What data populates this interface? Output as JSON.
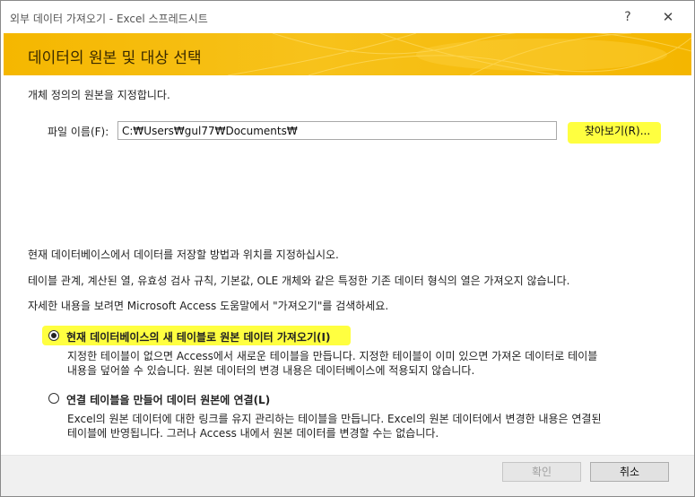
{
  "window": {
    "title": "외부 데이터 가져오기 - Excel 스프레드시트",
    "help_glyph": "?",
    "close_glyph": "✕"
  },
  "banner": {
    "title": "데이터의 원본 및 대상 선택"
  },
  "source": {
    "instruction": "개체 정의의 원본을 지정합니다.",
    "file_label": "파일 이름(F):",
    "file_value": "C:₩Users₩gul77₩Documents₩",
    "browse_label": "찾아보기(R)..."
  },
  "info": {
    "line1": "현재 데이터베이스에서 데이터를 저장할 방법과 위치를 지정하십시오.",
    "line2": "테이블 관계, 계산된 열, 유효성 검사 규칙, 기본값, OLE 개체와 같은 특정한 기존 데이터 형식의 열은 가져오지 않습니다.",
    "line3": "자세한 내용을 보려면 Microsoft Access 도움말에서 \"가져오기\"를 검색하세요."
  },
  "options": [
    {
      "label": "현재 데이터베이스의 새 테이블로 원본 데이터 가져오기(I)",
      "selected": true,
      "desc1": "지정한 테이블이 없으면 Access에서 새로운 테이블을 만듭니다. 지정한 테이블이 이미 있으면 가져온 데이터로 테이블",
      "desc2": "내용을 덮어쓸 수 있습니다. 원본 데이터의 변경 내용은 데이터베이스에 적용되지 않습니다."
    },
    {
      "label": "연결 테이블을 만들어 데이터 원본에 연결(L)",
      "selected": false,
      "desc1": "Excel의 원본 데이터에 대한 링크를 유지 관리하는 테이블을 만듭니다. Excel의 원본 데이터에서 변경한 내용은 연결된",
      "desc2": "테이블에 반영됩니다. 그러나 Access 내에서 원본 데이터를 변경할 수는 없습니다."
    }
  ],
  "footer": {
    "ok_label": "확인",
    "cancel_label": "취소"
  },
  "colors": {
    "banner": "#f5b700",
    "highlight": "#ffff00"
  }
}
